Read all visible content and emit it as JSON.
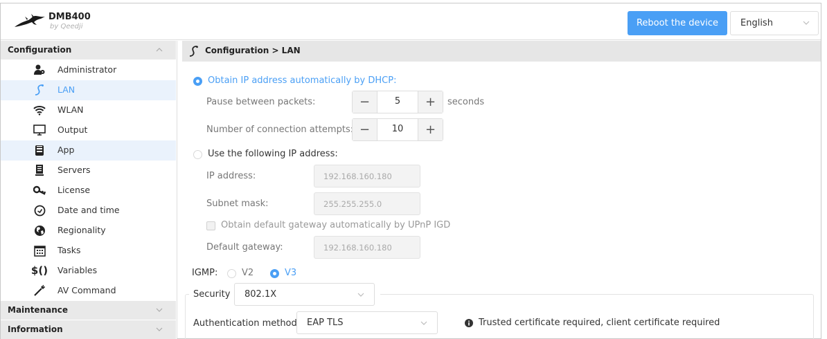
{
  "header": {
    "app_name": "DMB400",
    "app_sub": "by Qeedji",
    "reboot_label": "Reboot the device",
    "language": "English"
  },
  "sidebar": {
    "sections": [
      {
        "label": "Configuration"
      },
      {
        "label": "Maintenance"
      },
      {
        "label": "Information"
      }
    ],
    "items": [
      {
        "label": "Administrator",
        "icon": "administrator-icon"
      },
      {
        "label": "LAN",
        "icon": "lan-icon"
      },
      {
        "label": "WLAN",
        "icon": "wifi-icon"
      },
      {
        "label": "Output",
        "icon": "monitor-icon"
      },
      {
        "label": "App",
        "icon": "app-icon"
      },
      {
        "label": "Servers",
        "icon": "server-icon"
      },
      {
        "label": "License",
        "icon": "key-icon"
      },
      {
        "label": "Date and time",
        "icon": "clock-icon"
      },
      {
        "label": "Regionality",
        "icon": "globe-icon"
      },
      {
        "label": "Tasks",
        "icon": "calendar-icon"
      },
      {
        "label": "Variables",
        "icon": "variables-icon"
      },
      {
        "label": "AV Command",
        "icon": "av-command-icon"
      }
    ]
  },
  "main": {
    "breadcrumb": "Configuration > LAN",
    "dhcp": {
      "label": "Obtain IP address automatically by DHCP:",
      "pause_label": "Pause between packets:",
      "pause_value": "5",
      "pause_unit": "seconds",
      "attempts_label": "Number of connection attempts:",
      "attempts_value": "10"
    },
    "static": {
      "label": "Use the following IP address:",
      "ip_label": "IP address:",
      "ip_value": "192.168.160.180",
      "mask_label": "Subnet mask:",
      "mask_value": "255.255.255.0",
      "upnp_label": "Obtain default gateway automatically by UPnP IGD",
      "gateway_label": "Default gateway:",
      "gateway_value": "192.168.160.180"
    },
    "igmp": {
      "label": "IGMP:",
      "v2": "V2",
      "v3": "V3"
    },
    "security": {
      "label": "Security",
      "value": "802.1X",
      "auth_label": "Authentication method:",
      "auth_value": "EAP TLS",
      "info": "Trusted certificate required, client certificate required"
    }
  }
}
